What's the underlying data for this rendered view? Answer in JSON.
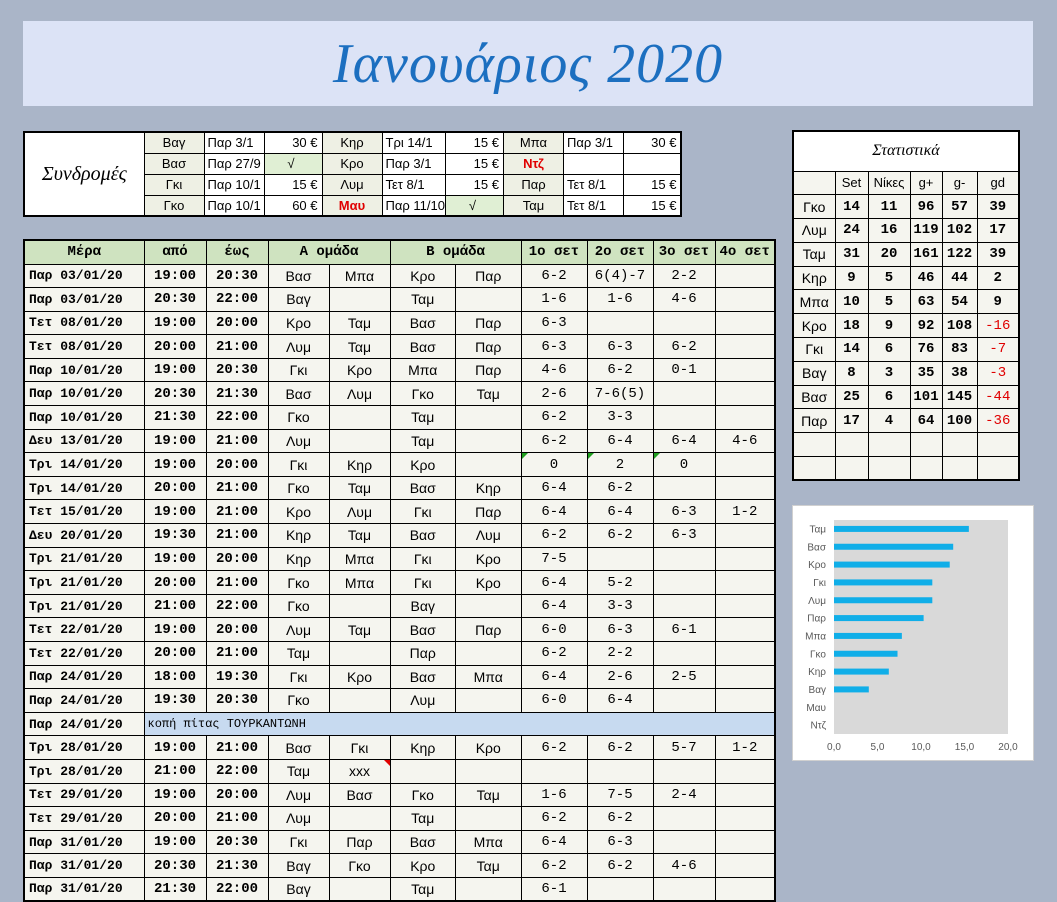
{
  "title": "Ιανουάριος 2020",
  "subscriptions": {
    "label": "Συνδρομές",
    "rows": [
      [
        {
          "name": "Βαγ",
          "date": "Παρ 3/1",
          "amount": "30 €"
        },
        {
          "name": "Κηρ",
          "date": "Τρι 14/1",
          "amount": "15 €"
        },
        {
          "name": "Μπα",
          "date": "Παρ 3/1",
          "amount": "30 €"
        }
      ],
      [
        {
          "name": "Βασ",
          "date": "Παρ 27/9",
          "amount": "√"
        },
        {
          "name": "Κρο",
          "date": "Παρ 3/1",
          "amount": "15 €"
        },
        {
          "name": "Ντζ",
          "date": "",
          "amount": ""
        }
      ],
      [
        {
          "name": "Γκι",
          "date": "Παρ 10/1",
          "amount": "15 €"
        },
        {
          "name": "Λυμ",
          "date": "Τετ 8/1",
          "amount": "15 €"
        },
        {
          "name": "Παρ",
          "date": "Τετ 8/1",
          "amount": "15 €"
        }
      ],
      [
        {
          "name": "Γκο",
          "date": "Παρ 10/1",
          "amount": "60 €"
        },
        {
          "name": "Μαυ",
          "date": "Παρ 11/10",
          "amount": "√"
        },
        {
          "name": "Ταμ",
          "date": "Τετ 8/1",
          "amount": "15 €"
        }
      ]
    ]
  },
  "schedule": {
    "headers": [
      "Μέρα",
      "από",
      "έως",
      "Α ομάδα",
      "Β ομάδα",
      "1ο σετ",
      "2ο σετ",
      "3ο σετ",
      "4ο σετ"
    ],
    "rows": [
      [
        "Παρ 03/01/20",
        "19:00",
        "20:30",
        "Βασ",
        "Μπα",
        "Κρο",
        "Παρ",
        "6-2",
        "6(4)-7",
        "2-2",
        ""
      ],
      [
        "Παρ 03/01/20",
        "20:30",
        "22:00",
        "Βαγ",
        "",
        "Ταμ",
        "",
        "1-6",
        "1-6",
        "4-6",
        ""
      ],
      [
        "Τετ 08/01/20",
        "19:00",
        "20:00",
        "Κρο",
        "Ταμ",
        "Βασ",
        "Παρ",
        "6-3",
        "",
        "",
        ""
      ],
      [
        "Τετ 08/01/20",
        "20:00",
        "21:00",
        "Λυμ",
        "Ταμ",
        "Βασ",
        "Παρ",
        "6-3",
        "6-3",
        "6-2",
        ""
      ],
      [
        "Παρ 10/01/20",
        "19:00",
        "20:30",
        "Γκι",
        "Κρο",
        "Μπα",
        "Παρ",
        "4-6",
        "6-2",
        "0-1",
        ""
      ],
      [
        "Παρ 10/01/20",
        "20:30",
        "21:30",
        "Βασ",
        "Λυμ",
        "Γκο",
        "Ταμ",
        "2-6",
        "7-6(5)",
        "",
        ""
      ],
      [
        "Παρ 10/01/20",
        "21:30",
        "22:00",
        "Γκο",
        "",
        "Ταμ",
        "",
        "6-2",
        "3-3",
        "",
        ""
      ],
      [
        "Δευ 13/01/20",
        "19:00",
        "21:00",
        "Λυμ",
        "",
        "Ταμ",
        "",
        "6-2",
        "6-4",
        "6-4",
        "4-6"
      ],
      [
        "Τρι 14/01/20",
        "19:00",
        "20:00",
        "Γκι",
        "Κηρ",
        "Κρο",
        "",
        "0",
        "2",
        "0",
        ""
      ],
      [
        "Τρι 14/01/20",
        "20:00",
        "21:00",
        "Γκο",
        "Ταμ",
        "Βασ",
        "Κηρ",
        "6-4",
        "6-2",
        "",
        ""
      ],
      [
        "Τετ 15/01/20",
        "19:00",
        "21:00",
        "Κρο",
        "Λυμ",
        "Γκι",
        "Παρ",
        "6-4",
        "6-4",
        "6-3",
        "1-2"
      ],
      [
        "Δευ 20/01/20",
        "19:30",
        "21:00",
        "Κηρ",
        "Ταμ",
        "Βασ",
        "Λυμ",
        "6-2",
        "6-2",
        "6-3",
        ""
      ],
      [
        "Τρι 21/01/20",
        "19:00",
        "20:00",
        "Κηρ",
        "Μπα",
        "Γκι",
        "Κρο",
        "7-5",
        "",
        "",
        ""
      ],
      [
        "Τρι 21/01/20",
        "20:00",
        "21:00",
        "Γκο",
        "Μπα",
        "Γκι",
        "Κρο",
        "6-4",
        "5-2",
        "",
        ""
      ],
      [
        "Τρι 21/01/20",
        "21:00",
        "22:00",
        "Γκο",
        "",
        "Βαγ",
        "",
        "6-4",
        "3-3",
        "",
        ""
      ],
      [
        "Τετ 22/01/20",
        "19:00",
        "20:00",
        "Λυμ",
        "Ταμ",
        "Βασ",
        "Παρ",
        "6-0",
        "6-3",
        "6-1",
        ""
      ],
      [
        "Τετ 22/01/20",
        "20:00",
        "21:00",
        "Ταμ",
        "",
        "Παρ",
        "",
        "6-2",
        "2-2",
        "",
        ""
      ],
      [
        "Παρ 24/01/20",
        "18:00",
        "19:30",
        "Γκι",
        "Κρο",
        "Βασ",
        "Μπα",
        "6-4",
        "2-6",
        "2-5",
        ""
      ],
      [
        "Παρ 24/01/20",
        "19:30",
        "20:30",
        "Γκο",
        "",
        "Λυμ",
        "",
        "6-0",
        "6-4",
        "",
        ""
      ],
      [
        "Παρ 24/01/20",
        "κοπή πίτας ΤΟΥΡΚΑΝΤΩΝΗ"
      ],
      [
        "Τρι 28/01/20",
        "19:00",
        "21:00",
        "Βασ",
        "Γκι",
        "Κηρ",
        "Κρο",
        "6-2",
        "6-2",
        "5-7",
        "1-2"
      ],
      [
        "Τρι 28/01/20",
        "21:00",
        "22:00",
        "Ταμ",
        "xxx",
        "",
        "",
        "",
        "",
        "",
        ""
      ],
      [
        "Τετ 29/01/20",
        "19:00",
        "20:00",
        "Λυμ",
        "Βασ",
        "Γκο",
        "Ταμ",
        "1-6",
        "7-5",
        "2-4",
        ""
      ],
      [
        "Τετ 29/01/20",
        "20:00",
        "21:00",
        "Λυμ",
        "",
        "Ταμ",
        "",
        "6-2",
        "6-2",
        "",
        ""
      ],
      [
        "Παρ 31/01/20",
        "19:00",
        "20:30",
        "Γκι",
        "Παρ",
        "Βασ",
        "Μπα",
        "6-4",
        "6-3",
        "",
        ""
      ],
      [
        "Παρ 31/01/20",
        "20:30",
        "21:30",
        "Βαγ",
        "Γκο",
        "Κρο",
        "Ταμ",
        "6-2",
        "6-2",
        "4-6",
        ""
      ],
      [
        "Παρ 31/01/20",
        "21:30",
        "22:00",
        "Βαγ",
        "",
        "Ταμ",
        "",
        "6-1",
        "",
        "",
        ""
      ]
    ]
  },
  "stats": {
    "title": "Στατιστικά",
    "headers": [
      "",
      "Set",
      "Νίκες",
      "g+",
      "g-",
      "gd"
    ],
    "rows": [
      [
        "Γκο",
        "14",
        "11",
        "96",
        "57",
        "39"
      ],
      [
        "Λυμ",
        "24",
        "16",
        "119",
        "102",
        "17"
      ],
      [
        "Ταμ",
        "31",
        "20",
        "161",
        "122",
        "39"
      ],
      [
        "Κηρ",
        "9",
        "5",
        "46",
        "44",
        "2"
      ],
      [
        "Μπα",
        "10",
        "5",
        "63",
        "54",
        "9"
      ],
      [
        "Κρο",
        "18",
        "9",
        "92",
        "108",
        "-16"
      ],
      [
        "Γκι",
        "14",
        "6",
        "76",
        "83",
        "-7"
      ],
      [
        "Βαγ",
        "8",
        "3",
        "35",
        "38",
        "-3"
      ],
      [
        "Βασ",
        "25",
        "6",
        "101",
        "145",
        "-44"
      ],
      [
        "Παρ",
        "17",
        "4",
        "64",
        "100",
        "-36"
      ],
      [
        "",
        "",
        "",
        "",
        "",
        ""
      ],
      [
        "",
        "",
        "",
        "",
        "",
        ""
      ]
    ]
  },
  "chart_data": {
    "type": "bar",
    "orientation": "horizontal",
    "categories": [
      "Ταμ",
      "Βασ",
      "Κρο",
      "Γκι",
      "Λυμ",
      "Παρ",
      "Μπα",
      "Γκο",
      "Κηρ",
      "Βαγ",
      "Μαυ",
      "Ντζ"
    ],
    "values": [
      15.5,
      13.7,
      13.3,
      11.3,
      11.3,
      10.3,
      7.8,
      7.3,
      6.3,
      4.0,
      0,
      0
    ],
    "xlim": [
      0,
      20
    ],
    "xticks": [
      "0,0",
      "5,0",
      "10,0",
      "15,0",
      "20,0"
    ],
    "bar_color": "#10aee8",
    "plot_bg": "#d9d9d9"
  }
}
